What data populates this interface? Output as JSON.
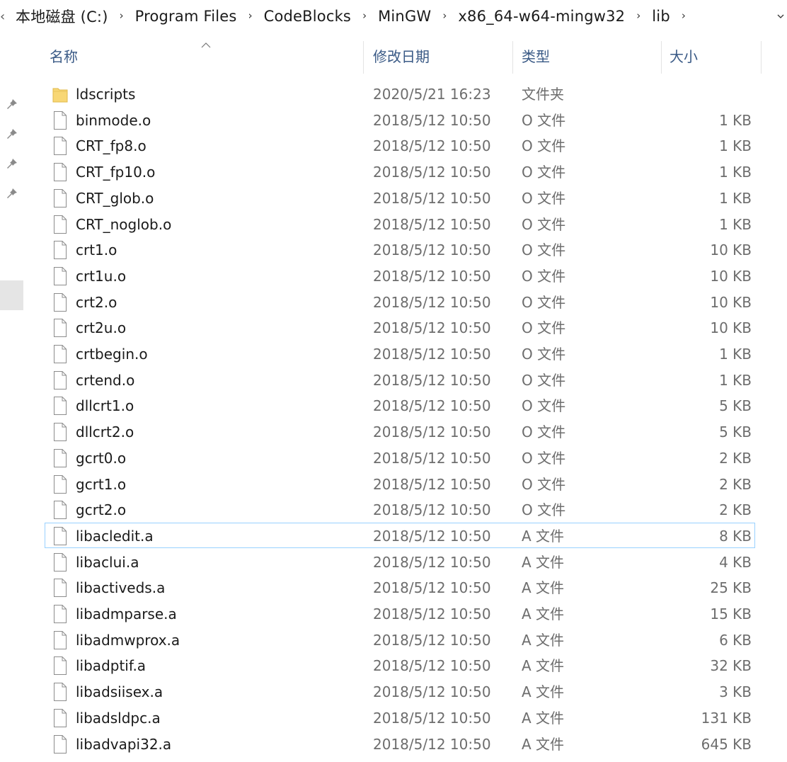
{
  "breadcrumb": {
    "segments": [
      "本地磁盘 (C:)",
      "Program Files",
      "CodeBlocks",
      "MinGW",
      "x86_64-w64-mingw32",
      "lib"
    ],
    "separator": "›"
  },
  "columns": {
    "name": "名称",
    "date": "修改日期",
    "type": "类型",
    "size": "大小"
  },
  "files": [
    {
      "name": "ldscripts",
      "date": "2020/5/21 16:23",
      "type": "文件夹",
      "size": "",
      "icon": "folder-icon"
    },
    {
      "name": "binmode.o",
      "date": "2018/5/12 10:50",
      "type": "O 文件",
      "size": "1 KB",
      "icon": "file-icon"
    },
    {
      "name": "CRT_fp8.o",
      "date": "2018/5/12 10:50",
      "type": "O 文件",
      "size": "1 KB",
      "icon": "file-icon"
    },
    {
      "name": "CRT_fp10.o",
      "date": "2018/5/12 10:50",
      "type": "O 文件",
      "size": "1 KB",
      "icon": "file-icon"
    },
    {
      "name": "CRT_glob.o",
      "date": "2018/5/12 10:50",
      "type": "O 文件",
      "size": "1 KB",
      "icon": "file-icon"
    },
    {
      "name": "CRT_noglob.o",
      "date": "2018/5/12 10:50",
      "type": "O 文件",
      "size": "1 KB",
      "icon": "file-icon"
    },
    {
      "name": "crt1.o",
      "date": "2018/5/12 10:50",
      "type": "O 文件",
      "size": "10 KB",
      "icon": "file-icon"
    },
    {
      "name": "crt1u.o",
      "date": "2018/5/12 10:50",
      "type": "O 文件",
      "size": "10 KB",
      "icon": "file-icon"
    },
    {
      "name": "crt2.o",
      "date": "2018/5/12 10:50",
      "type": "O 文件",
      "size": "10 KB",
      "icon": "file-icon"
    },
    {
      "name": "crt2u.o",
      "date": "2018/5/12 10:50",
      "type": "O 文件",
      "size": "10 KB",
      "icon": "file-icon"
    },
    {
      "name": "crtbegin.o",
      "date": "2018/5/12 10:50",
      "type": "O 文件",
      "size": "1 KB",
      "icon": "file-icon"
    },
    {
      "name": "crtend.o",
      "date": "2018/5/12 10:50",
      "type": "O 文件",
      "size": "1 KB",
      "icon": "file-icon"
    },
    {
      "name": "dllcrt1.o",
      "date": "2018/5/12 10:50",
      "type": "O 文件",
      "size": "5 KB",
      "icon": "file-icon"
    },
    {
      "name": "dllcrt2.o",
      "date": "2018/5/12 10:50",
      "type": "O 文件",
      "size": "5 KB",
      "icon": "file-icon"
    },
    {
      "name": "gcrt0.o",
      "date": "2018/5/12 10:50",
      "type": "O 文件",
      "size": "2 KB",
      "icon": "file-icon"
    },
    {
      "name": "gcrt1.o",
      "date": "2018/5/12 10:50",
      "type": "O 文件",
      "size": "2 KB",
      "icon": "file-icon"
    },
    {
      "name": "gcrt2.o",
      "date": "2018/5/12 10:50",
      "type": "O 文件",
      "size": "2 KB",
      "icon": "file-icon"
    },
    {
      "name": "libacledit.a",
      "date": "2018/5/12 10:50",
      "type": "A 文件",
      "size": "8 KB",
      "icon": "file-icon",
      "focused": true
    },
    {
      "name": "libaclui.a",
      "date": "2018/5/12 10:50",
      "type": "A 文件",
      "size": "4 KB",
      "icon": "file-icon"
    },
    {
      "name": "libactiveds.a",
      "date": "2018/5/12 10:50",
      "type": "A 文件",
      "size": "25 KB",
      "icon": "file-icon"
    },
    {
      "name": "libadmparse.a",
      "date": "2018/5/12 10:50",
      "type": "A 文件",
      "size": "15 KB",
      "icon": "file-icon"
    },
    {
      "name": "libadmwprox.a",
      "date": "2018/5/12 10:50",
      "type": "A 文件",
      "size": "6 KB",
      "icon": "file-icon"
    },
    {
      "name": "libadptif.a",
      "date": "2018/5/12 10:50",
      "type": "A 文件",
      "size": "32 KB",
      "icon": "file-icon"
    },
    {
      "name": "libadsiisex.a",
      "date": "2018/5/12 10:50",
      "type": "A 文件",
      "size": "3 KB",
      "icon": "file-icon"
    },
    {
      "name": "libadsldpc.a",
      "date": "2018/5/12 10:50",
      "type": "A 文件",
      "size": "131 KB",
      "icon": "file-icon"
    },
    {
      "name": "libadvapi32.a",
      "date": "2018/5/12 10:50",
      "type": "A 文件",
      "size": "645 KB",
      "icon": "file-icon"
    }
  ],
  "quick_access_pins": [
    "pin-icon",
    "pin-icon",
    "pin-icon",
    "pin-icon"
  ],
  "colors": {
    "header_text": "#3a5a86",
    "meta_text": "#6d6d6d",
    "focus_border": "#99d1ff",
    "folder_fill": "#f8d775"
  }
}
